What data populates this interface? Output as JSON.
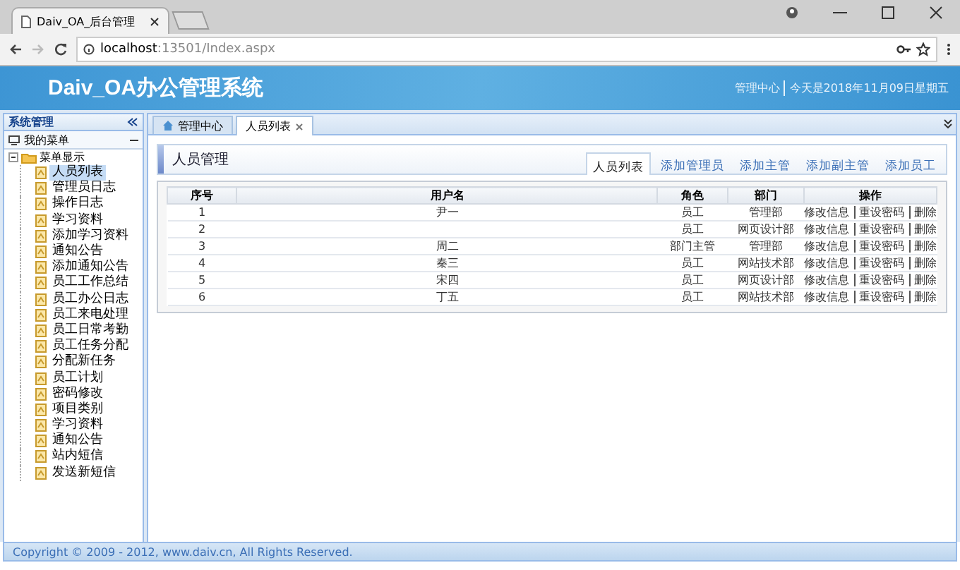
{
  "browser": {
    "tab_title": "Daiv_OA_后台管理",
    "url_host": "localhost",
    "url_rest": ":13501/Index.aspx"
  },
  "header": {
    "title": "Daiv_OA办公管理系统",
    "links": [
      "管理中心",
      "今天是2018年11月09日星期五"
    ]
  },
  "sidebar": {
    "title": "系统管理",
    "menu_title": "我的菜单",
    "tree": {
      "label": "菜单显示",
      "expanded": true,
      "children": [
        {
          "label": "人员列表",
          "selected": true
        },
        {
          "label": "管理员日志",
          "selected": false
        },
        {
          "label": "操作日志",
          "selected": false
        },
        {
          "label": "学习资料",
          "selected": false
        },
        {
          "label": "添加学习资料",
          "selected": false
        },
        {
          "label": "通知公告",
          "selected": false
        },
        {
          "label": "添加通知公告",
          "selected": false
        },
        {
          "label": "员工工作总结",
          "selected": false
        },
        {
          "label": "员工办公日志",
          "selected": false
        },
        {
          "label": "员工来电处理",
          "selected": false
        },
        {
          "label": "员工日常考勤",
          "selected": false
        },
        {
          "label": "员工任务分配",
          "selected": false
        },
        {
          "label": "分配新任务",
          "selected": false
        },
        {
          "label": "员工计划",
          "selected": false
        },
        {
          "label": "密码修改",
          "selected": false
        },
        {
          "label": "项目类别",
          "selected": false
        },
        {
          "label": "学习资料",
          "selected": false
        },
        {
          "label": "通知公告",
          "selected": false
        },
        {
          "label": "站内短信",
          "selected": false
        },
        {
          "label": "发送新短信",
          "selected": false
        }
      ]
    }
  },
  "content_tabs": [
    {
      "label": "管理中心",
      "selected": false,
      "closable": false
    },
    {
      "label": "人员列表",
      "selected": true,
      "closable": true
    }
  ],
  "panel": {
    "title": "人员管理",
    "tabs": [
      {
        "label": "人员列表",
        "selected": true
      },
      {
        "label": "添加管理员",
        "selected": false
      },
      {
        "label": "添加主管",
        "selected": false
      },
      {
        "label": "添加副主管",
        "selected": false
      },
      {
        "label": "添加员工",
        "selected": false
      }
    ]
  },
  "table": {
    "columns": [
      "序号",
      "用户名",
      "角色",
      "部门",
      "操作"
    ],
    "rows": [
      {
        "cells": [
          "1",
          "尹一",
          "员工",
          "管理部"
        ],
        "actions": [
          "修改信息",
          "重设密码",
          "删除"
        ]
      },
      {
        "cells": [
          "2",
          "",
          "员工",
          "网页设计部"
        ],
        "actions": [
          "修改信息",
          "重设密码",
          "删除"
        ]
      },
      {
        "cells": [
          "3",
          "周二",
          "部门主管",
          "管理部"
        ],
        "actions": [
          "修改信息",
          "重设密码",
          "删除"
        ]
      },
      {
        "cells": [
          "4",
          "秦三",
          "员工",
          "网站技术部"
        ],
        "actions": [
          "修改信息",
          "重设密码",
          "删除"
        ]
      },
      {
        "cells": [
          "5",
          "宋四",
          "员工",
          "网页设计部"
        ],
        "actions": [
          "修改信息",
          "重设密码",
          "删除"
        ]
      },
      {
        "cells": [
          "6",
          "丁五",
          "员工",
          "网站技术部"
        ],
        "actions": [
          "修改信息",
          "重设密码",
          "删除"
        ]
      }
    ]
  },
  "footer": "Copyright © 2009 - 2012, www.daiv.cn, All Rights Reserved."
}
